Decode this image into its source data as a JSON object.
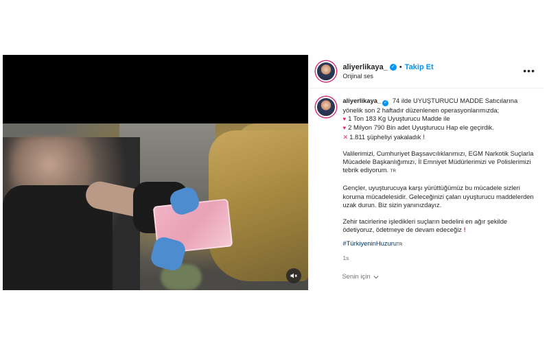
{
  "post": {
    "username": "aliyerlikaya_",
    "follow_label": "Takip Et",
    "audio_label": "Orijinal ses",
    "separator": "•",
    "more_options": "•••"
  },
  "caption": {
    "username": "aliyerlikaya_",
    "line_intro": "74 ilde UYUŞTURUCU MADDE Satıcılarına yönelik son 2 haftadır düzenlenen operasyonlarımızda;",
    "bullet_1": "1 Ton 183 Kg Uyuşturucu Madde ile",
    "bullet_2": "2 Milyon 790 Bin adet Uyuşturucu Hap ele geçirdik.",
    "suspects": "1.811 şüpheliyi yakaladık",
    "para_thanks": "Valilerimizi, Cumhuriyet Başsavcılıklarımızı, EGM Narkotik Suçlarla Mücadele Başkanlığımızı, İl Emniyet Müdürlerimizi ve Polislerimizi tebrik ediyorum.",
    "tr_flag_1": "TR",
    "para_youth": "Gençler, uyuşturucuya karşı yürüttüğümüz bu mücadele sizleri koruma mücadelesidir. Geleceğinizi çalan uyuşturucu maddelerden uzak durun. Biz sizin yanınızdayız.",
    "para_dealers": "Zehir tacirlerine işledikleri suçların bedelini en ağır şekilde ödetiyoruz, ödetmeye de devam edeceğiz",
    "hashtag": "#TürkiyeninHuzuru",
    "tr_flag_2": "TR",
    "timestamp": "1s"
  },
  "translation": {
    "label": "Senin için"
  },
  "colors": {
    "link_blue": "#0095f6",
    "hashtag_blue": "#00376b",
    "heart_red": "#e0245e",
    "verified_blue": "#0095f6"
  },
  "icons": {
    "verified": "verified-badge-icon",
    "heart_bullet": "red-heart-icon",
    "cross": "cross-mark-icon",
    "exclamation": "red-exclamation-icon",
    "mute": "speaker-muted-icon",
    "more": "ellipsis-icon",
    "chevron": "chevron-down-icon"
  }
}
